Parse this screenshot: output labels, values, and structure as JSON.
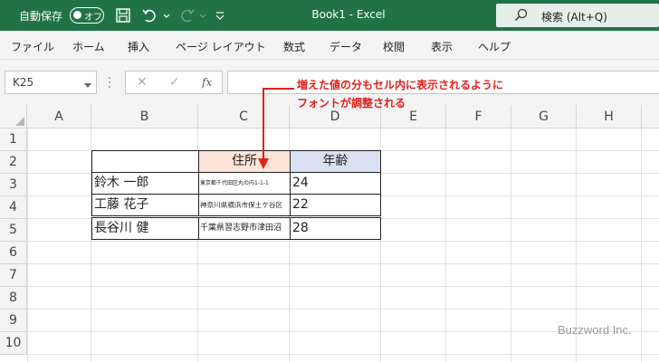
{
  "titlebar": {
    "autosave_label": "自動保存",
    "toggle_state": "オフ",
    "book_title": "Book1  -  Excel",
    "search_label": "検索 (Alt+Q)"
  },
  "ribbon": {
    "tabs": [
      "ファイル",
      "ホーム",
      "挿入",
      "ページ レイアウト",
      "数式",
      "データ",
      "校閲",
      "表示",
      "ヘルプ"
    ]
  },
  "formula_bar": {
    "name_box": "K25",
    "cancel_glyph": "✕",
    "enter_glyph": "✓",
    "fx_label": "fx",
    "formula": ""
  },
  "grid": {
    "columns": [
      "A",
      "B",
      "C",
      "D",
      "E",
      "F",
      "G",
      "H"
    ],
    "rows": [
      "1",
      "2",
      "3",
      "4",
      "5",
      "6",
      "7",
      "8",
      "9",
      "10"
    ]
  },
  "table": {
    "header_address": "住所",
    "header_age": "年齢",
    "rows": [
      {
        "name": "鈴木 一郎",
        "address": "東京都千代田区丸の内1-1-1",
        "age": "24"
      },
      {
        "name": "工藤 花子",
        "address": "神奈川県横浜市保土ケ谷区",
        "age": "22"
      },
      {
        "name": "長谷川 健",
        "address": "千葉県習志野市津田沼",
        "age": "28"
      }
    ]
  },
  "annotation": {
    "line1": "増えた値の分もセル内に表示されるように",
    "line2": "フォントが調整される",
    "color": "#e0201b"
  },
  "watermark": "Buzzword Inc.",
  "colors": {
    "excel_green": "#217346",
    "header_address_fill": "#fce4d6",
    "header_age_fill": "#d9e1f2"
  }
}
